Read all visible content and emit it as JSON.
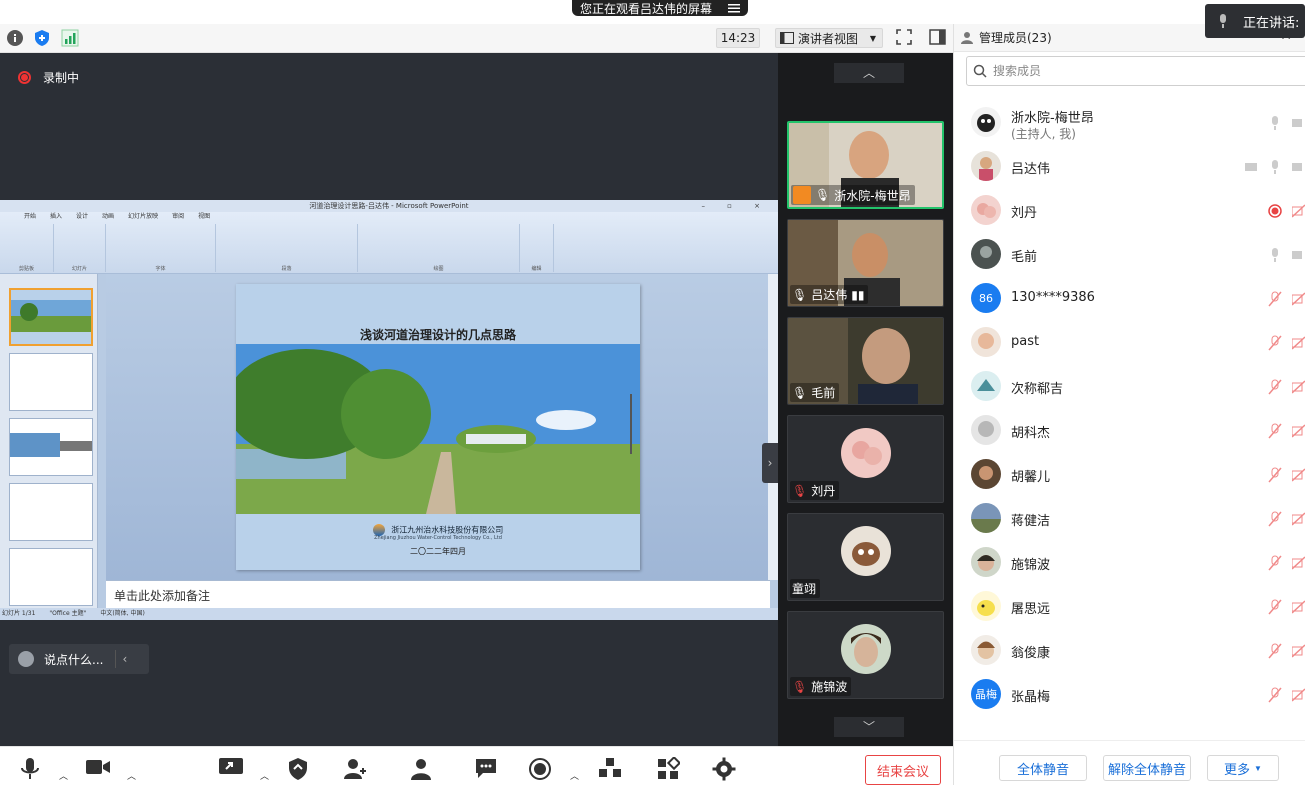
{
  "banner": {
    "text": "您正在观看吕达伟的屏幕"
  },
  "toolbar": {
    "time": "14:23",
    "view_label": "演讲者视图"
  },
  "recording": {
    "label": "录制中"
  },
  "presentation": {
    "window_title": "河道治理设计思路-吕达伟 - Microsoft PowerPoint",
    "ribbon_tabs": [
      "开始",
      "插入",
      "设计",
      "动画",
      "幻灯片放映",
      "审阅",
      "视图"
    ],
    "ribbon_groups": [
      "剪贴板",
      "幻灯片",
      "字体",
      "段落",
      "绘图",
      "编辑"
    ],
    "slide_title": "浅谈河道治理设计的几点思路",
    "company_cn": "浙江九州治水科技股份有限公司",
    "company_en": "Zhejiang Jiuzhou Water-Control Technology Co., Ltd",
    "slide_date": "二〇二二年四月",
    "notes_placeholder": "单击此处添加备注",
    "status_slide": "幻灯片 1/31",
    "status_theme": "\"Office 主题\"",
    "status_lang": "中文(简体, 中国)"
  },
  "chat": {
    "placeholder": "说点什么..."
  },
  "videos": [
    {
      "name": "浙水院-梅世昂",
      "host": true,
      "active": true
    },
    {
      "name": "吕达伟",
      "host": false,
      "active": false
    },
    {
      "name": "毛前",
      "host": false,
      "active": false
    },
    {
      "name": "刘丹",
      "host": false,
      "active": false
    },
    {
      "name": "童翊",
      "host": false,
      "active": false
    },
    {
      "name": "施锦波",
      "host": false,
      "active": false
    }
  ],
  "end_meeting": "结束会议",
  "panel": {
    "title": "管理成员(23)",
    "search_placeholder": "搜索成员",
    "members": [
      {
        "name": "浙水院-梅世昂",
        "sub": "(主持人, 我)",
        "avatar_text": ""
      },
      {
        "name": "吕达伟",
        "sub": "",
        "avatar_text": ""
      },
      {
        "name": "刘丹",
        "sub": "",
        "avatar_text": ""
      },
      {
        "name": "毛前",
        "sub": "",
        "avatar_text": ""
      },
      {
        "name": "130****9386",
        "sub": "",
        "avatar_text": "86"
      },
      {
        "name": "past",
        "sub": "",
        "avatar_text": ""
      },
      {
        "name": "次称郗吉",
        "sub": "",
        "avatar_text": ""
      },
      {
        "name": "胡科杰",
        "sub": "",
        "avatar_text": ""
      },
      {
        "name": "胡馨儿",
        "sub": "",
        "avatar_text": ""
      },
      {
        "name": "蒋健洁",
        "sub": "",
        "avatar_text": ""
      },
      {
        "name": "施锦波",
        "sub": "",
        "avatar_text": ""
      },
      {
        "name": "屠思远",
        "sub": "",
        "avatar_text": ""
      },
      {
        "name": "翁俊康",
        "sub": "",
        "avatar_text": ""
      },
      {
        "name": "张晶梅",
        "sub": "",
        "avatar_text": "晶梅"
      }
    ],
    "mute_all": "全体静音",
    "unmute_all": "解除全体静音",
    "more": "更多"
  },
  "speaking": {
    "label": "正在讲话: 吕"
  },
  "colors": {
    "accent": "#1a7cf0",
    "danger": "#e84444",
    "active_speaker": "#23c36b",
    "stage_bg": "#2b2f36"
  }
}
